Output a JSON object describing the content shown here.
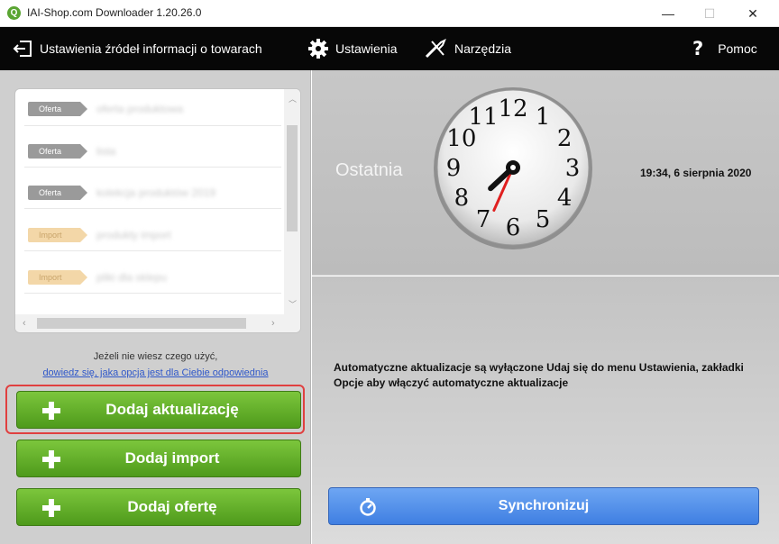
{
  "window": {
    "title": "IAI-Shop.com Downloader 1.20.26.0",
    "app_icon_glyph": "Q",
    "min_glyph": "—",
    "max_glyph": "☐",
    "close_glyph": "✕"
  },
  "toolbar": {
    "sources_label": "Ustawienia źródeł informacji o towarach",
    "settings_label": "Ustawienia",
    "tools_label": "Narzędzia",
    "help_glyph": "?",
    "help_label": "Pomoc"
  },
  "sources_list": {
    "items": [
      {
        "badge": "Oferta",
        "kind": "oferta",
        "name": "oferta produktowa"
      },
      {
        "badge": "Oferta",
        "kind": "oferta",
        "name": "lista"
      },
      {
        "badge": "Oferta",
        "kind": "oferta",
        "name": "kolekcja produktów 2019"
      },
      {
        "badge": "Import",
        "kind": "import",
        "name": "produkty import"
      },
      {
        "badge": "Import",
        "kind": "import",
        "name": "pliki dla sklepu"
      }
    ]
  },
  "hint": {
    "text": "Jeżeli nie wiesz czego użyć,",
    "link": "dowiedz się, jaka opcja jest dla Ciebie odpowiednia"
  },
  "buttons": {
    "add_update": "Dodaj aktualizację",
    "add_import": "Dodaj import",
    "add_offer": "Dodaj ofertę",
    "sync": "Synchronizuj"
  },
  "last_sync": {
    "label": "Ostatnia",
    "time": "19:34, 6 sierpnia 2020",
    "clock_hours": 19,
    "clock_minutes": 34
  },
  "auto_update_message": "Automatyczne aktualizacje są wyłączone Udaj się do menu Ustawienia, zakładki Opcje aby włączyć automatyczne aktualizacje",
  "colors": {
    "green_button": "#5fad26",
    "blue_button": "#4f8ce8",
    "toolbar": "#070707",
    "highlight": "#e04040"
  },
  "icons": {
    "sources": "login-arrow-icon",
    "settings": "gear-icon",
    "tools": "wrench-icon",
    "help": "question-icon",
    "add": "plus-icon",
    "sync": "sync-icon"
  }
}
